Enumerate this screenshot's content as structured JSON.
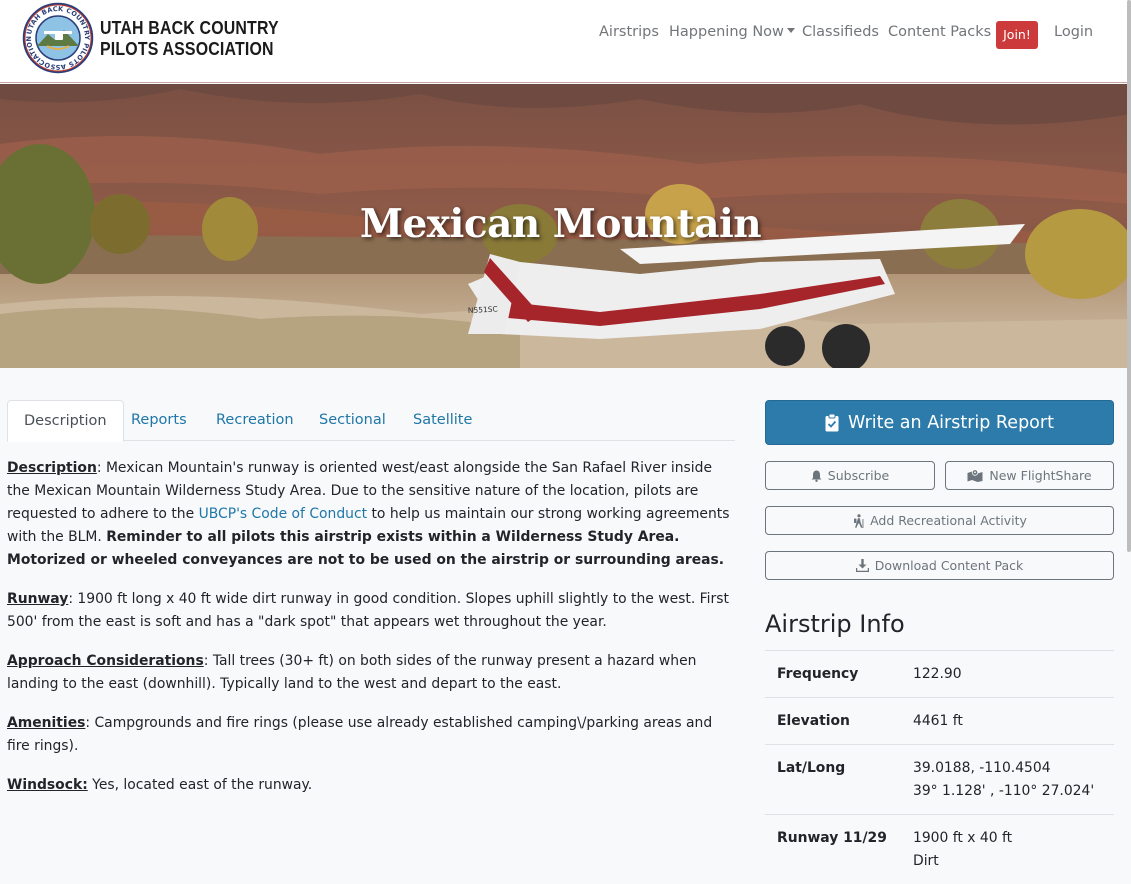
{
  "site": {
    "name_line1": "UTAH BACK COUNTRY",
    "name_line2": "PILOTS ASSOCIATION",
    "logo_ring_text": "UTAH BACK COUNTRY PILOTS ASSOCIATION"
  },
  "nav": {
    "airstrips": "Airstrips",
    "happening_now": "Happening Now",
    "classifieds": "Classifieds",
    "content_packs": "Content Packs",
    "join": "Join!",
    "login": "Login"
  },
  "hero": {
    "title": "Mexican Mountain",
    "tail_number": "N551SC"
  },
  "tabs": [
    "Description",
    "Reports",
    "Recreation",
    "Sectional",
    "Satellite"
  ],
  "description": {
    "p1_label": "Description",
    "p1_text_a": ": Mexican Mountain's runway is oriented west/east alongside the San Rafael River inside the Mexican Mountain Wilderness Study Area. Due to the sensitive nature of the location, pilots are requested to adhere to the ",
    "p1_link": "UBCP's Code of Conduct",
    "p1_text_b": " to help us maintain our strong working agreements with the BLM. ",
    "p1_bold": "Reminder to all pilots this airstrip exists within a Wilderness Study Area. Motorized or wheeled conveyances are not to be used on the airstrip or surrounding areas.",
    "p2_label": "Runway",
    "p2_text": ": 1900 ft long x 40 ft wide dirt runway in good condition. Slopes uphill slightly to the west. First 500' from the east is soft and has a \"dark spot\" that appears wet throughout the year.",
    "p3_label": "Approach Considerations",
    "p3_text": ": Tall trees (30+ ft) on both sides of the runway present a hazard when landing to the east (downhill). Typically land to the west and depart to the east.",
    "p4_label": "Amenities",
    "p4_text": ": Campgrounds and fire rings (please use already established camping\\/parking areas and fire rings).",
    "p5_label": "Windsock:",
    "p5_text": " Yes, located east of the runway."
  },
  "sidebar": {
    "write_report": "Write an Airstrip Report",
    "subscribe": "Subscribe",
    "new_flightshare": "New FlightShare",
    "add_recreational": "Add Recreational Activity",
    "download_content_pack": "Download Content Pack"
  },
  "airstrip_info": {
    "title": "Airstrip Info",
    "frequency_label": "Frequency",
    "frequency_value": "122.90",
    "elevation_label": "Elevation",
    "elevation_value": "4461 ft",
    "latlong_label": "Lat/Long",
    "latlong_decimal": "39.0188, -110.4504",
    "latlong_dms": "39° 1.128' , -110° 27.024'",
    "runway_label": "Runway 11/29",
    "runway_dims": "1900 ft x 40 ft",
    "runway_surface": "Dirt"
  },
  "colors": {
    "join_button": "#cc3a3c",
    "primary_button": "#2c7bab",
    "link": "#1f77a8"
  },
  "icons": {
    "write_report": "clipboard-check-icon",
    "subscribe": "bell-icon",
    "new_flightshare": "map-marked-icon",
    "add_recreational": "hiking-icon",
    "download": "download-icon",
    "happening_dropdown": "caret-down-icon"
  }
}
